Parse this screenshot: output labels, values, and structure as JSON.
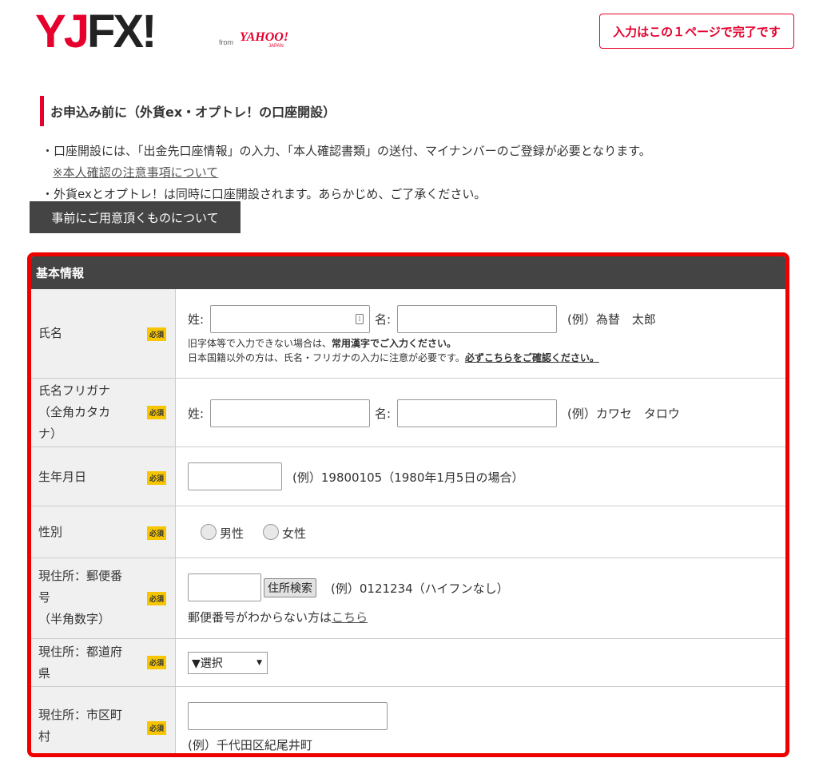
{
  "logo": {
    "y": "Y",
    "j": "J",
    "fx": "FX!",
    "from": "from",
    "yahoo": "YAHOO!",
    "japan": "JAPAN"
  },
  "header": {
    "badge": "入力はこの１ページで完了です"
  },
  "section": {
    "title": "お申込み前に（外貨ex・オプトレ！の口座開設）",
    "note1": "・口座開設には、「出金先口座情報」の入力、「本人確認書類」の送付、マイナンバーのご登録が必要となります。",
    "note1_link": "※本人確認の注意事項について",
    "note2": "・外貨exとオプトレ！は同時に口座開設されます。あらかじめ、ご了承ください。",
    "prep_button": "事前にご用意頂くものについて"
  },
  "form": {
    "title": "基本情報",
    "required": "必須",
    "name": {
      "label": "氏名",
      "sei": "姓:",
      "mei": "名:",
      "example": "(例）為替　太郎",
      "note1_prefix": "旧字体等で入力できない場合は、",
      "note1_bold": "常用漢字でご入力ください。",
      "note2_prefix": "日本国籍以外の方は、氏名・フリガナの入力に注意が必要です。",
      "note2_link": "必ずこちらをご確認ください。"
    },
    "kana": {
      "label_l1": "氏名フリガナ",
      "label_l2": "（全角カタカ",
      "label_l3": "ナ）",
      "sei": "姓:",
      "mei": "名:",
      "example": "(例）カワセ　タロウ"
    },
    "birth": {
      "label": "生年月日",
      "example": "(例）19800105（1980年1月5日の場合）"
    },
    "gender": {
      "label": "性別",
      "male": "男性",
      "female": "女性"
    },
    "zip": {
      "label_l1": "現住所：郵便番",
      "label_l2": "号",
      "label_l3": "（半角数字）",
      "button": "住所検索",
      "example": "(例）0121234（ハイフンなし）",
      "help_prefix": "郵便番号がわからない方は",
      "help_link": "こちら"
    },
    "pref": {
      "label_l1": "現住所：都道府",
      "label_l2": "県",
      "selected": "▼選択"
    },
    "city": {
      "label_l1": "現住所：市区町",
      "label_l2": "村",
      "example": "(例）千代田区紀尾井町"
    }
  }
}
